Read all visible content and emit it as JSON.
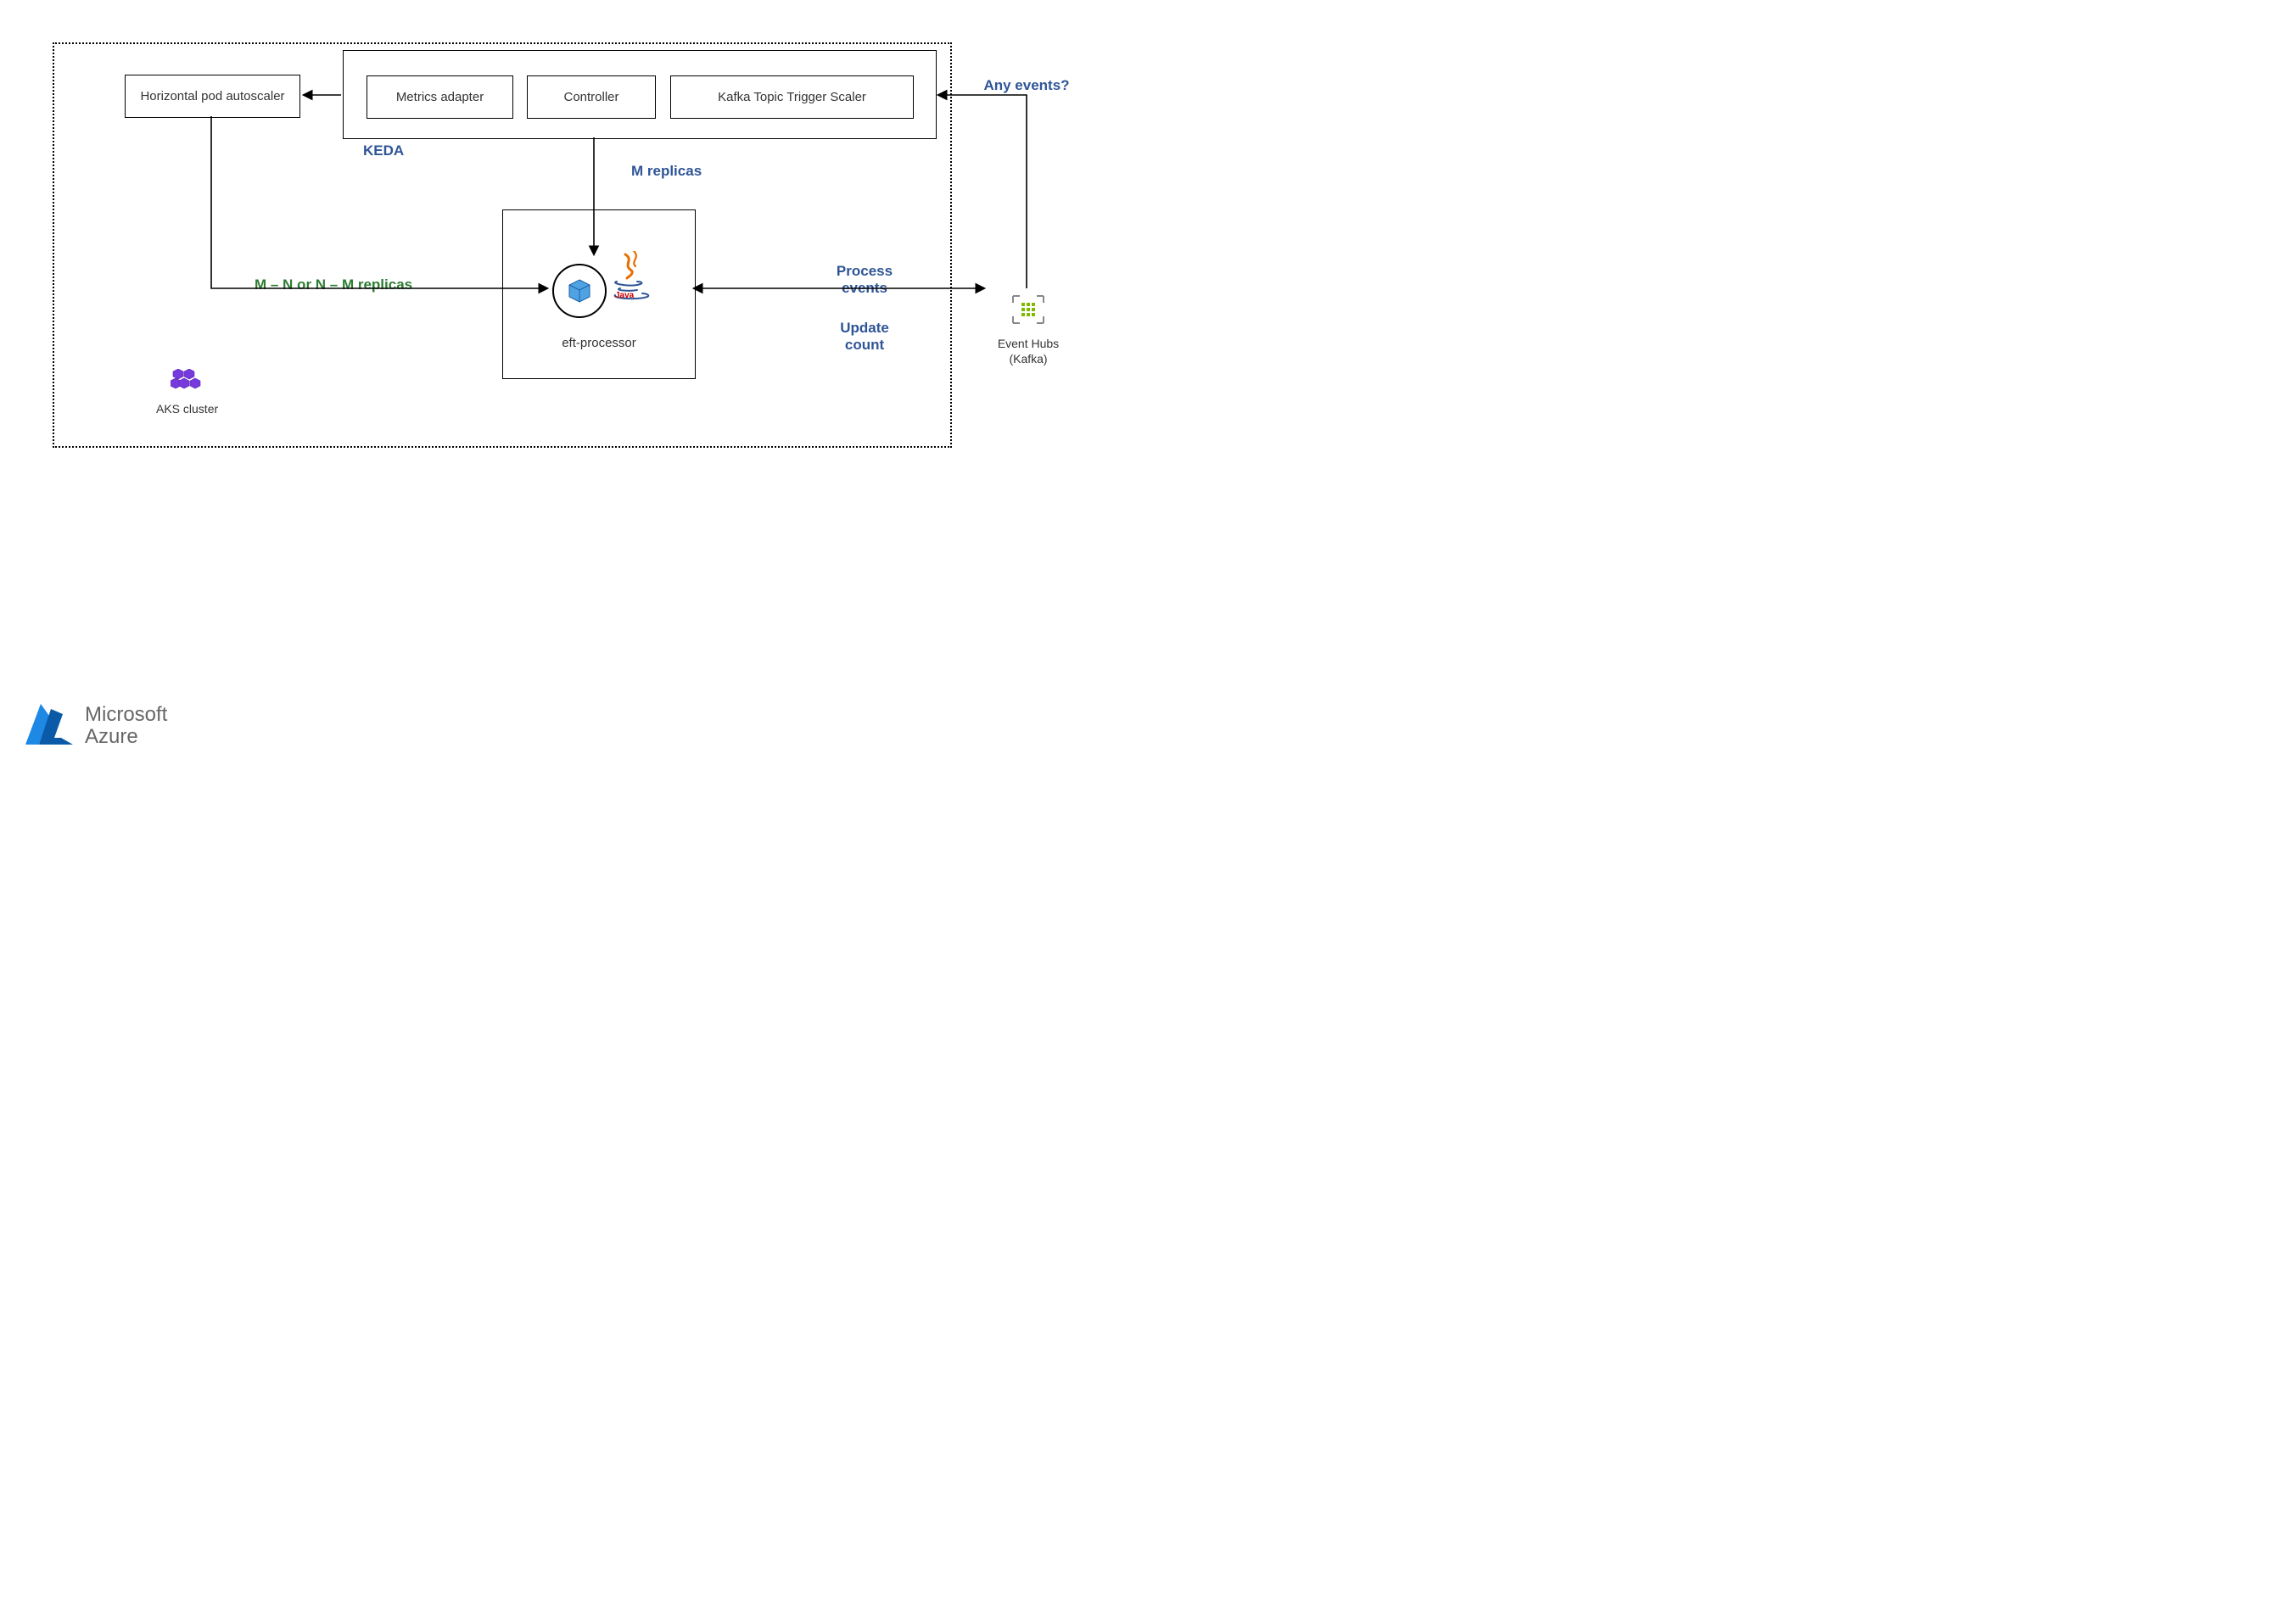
{
  "cluster_border_label": "AKS cluster",
  "hpa_label": "Horizontal pod autoscaler",
  "keda": {
    "label": "KEDA",
    "metrics_adapter": "Metrics adapter",
    "controller": "Controller",
    "kafka_scaler": "Kafka Topic Trigger Scaler"
  },
  "pod": {
    "name": "eft-processor"
  },
  "labels": {
    "m_replicas": "M replicas",
    "mn_replicas": "M – N or N – M replicas",
    "process_events": "Process events",
    "update_count": "Update count",
    "any_events": "Any events?"
  },
  "event_hubs": {
    "line1": "Event Hubs",
    "line2": "(Kafka)"
  },
  "brand": {
    "line1": "Microsoft",
    "line2": "Azure"
  },
  "colors": {
    "accent_blue": "#2F5597",
    "accent_green": "#2E7D32",
    "azure_blue": "#0078D4",
    "eh_green": "#7FBA00",
    "aks_purple": "#773ADC",
    "java_red": "#E76F00"
  }
}
